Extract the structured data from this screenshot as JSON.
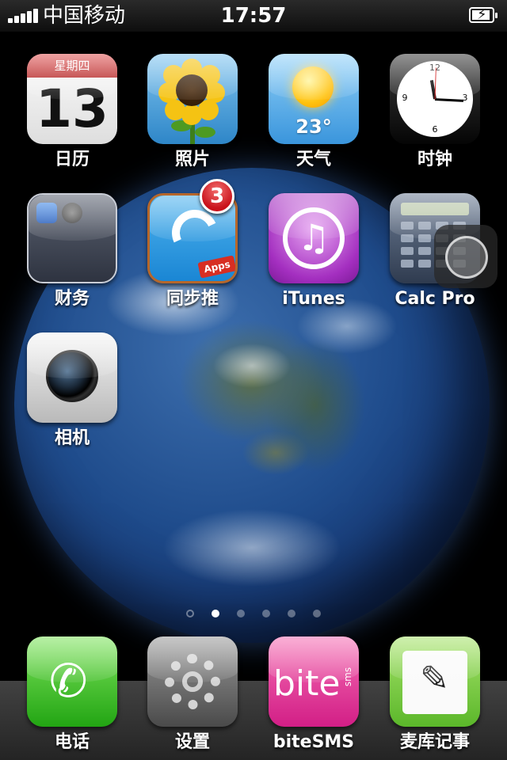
{
  "status_bar": {
    "carrier": "中国移动",
    "time": "17:57",
    "battery_level": 0.9
  },
  "apps": {
    "calendar": {
      "label": "日历",
      "weekday": "星期四",
      "day": "13"
    },
    "photos": {
      "label": "照片"
    },
    "weather": {
      "label": "天气",
      "temperature": "23°"
    },
    "clock": {
      "label": "时钟"
    },
    "finance_folder": {
      "label": "财务"
    },
    "tongbutui": {
      "label": "同步推",
      "badge": "3",
      "tag": "Apps"
    },
    "itunes": {
      "label": "iTunes"
    },
    "calc_pro": {
      "label": "Calc Pro"
    },
    "camera": {
      "label": "相机"
    }
  },
  "page_indicator": {
    "pages": 6,
    "current": 1
  },
  "dock": {
    "phone": {
      "label": "电话"
    },
    "settings": {
      "label": "设置"
    },
    "bitesms": {
      "label": "biteSMS",
      "icon_text": "bite",
      "icon_sub": "sms"
    },
    "notes": {
      "label": "麦库记事"
    }
  },
  "colors": {
    "badge_red": "#c9111a",
    "calendar_red": "#b21b1b",
    "bite_pink": "#d21e86"
  }
}
